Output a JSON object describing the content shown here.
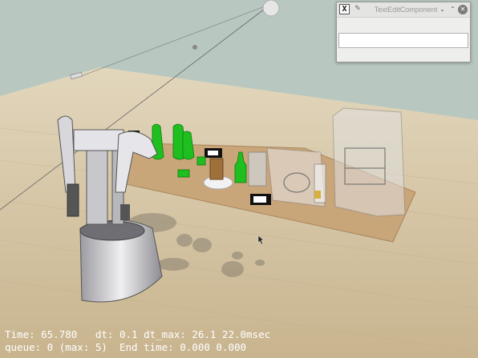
{
  "window": {
    "title": "TextEditComponent",
    "icon_label": "X",
    "text_value": ""
  },
  "hud": {
    "line1": "Time: 65.780   dt: 0.1 dt_max: 26.1 22.0msec",
    "line2": "queue: 0 (max: 5)  End time: 0.000 0.000"
  },
  "colors": {
    "floor": "#cdbf9e",
    "wall": "#b8c8c0",
    "table": "#c9a57a",
    "green_objects": "#1fbf1f",
    "robot": "#d8d8dc"
  },
  "icons": [
    "app-icon",
    "pin-icon",
    "minimize-icon",
    "maximize-icon",
    "close-icon",
    "mouse-cursor-icon"
  ]
}
